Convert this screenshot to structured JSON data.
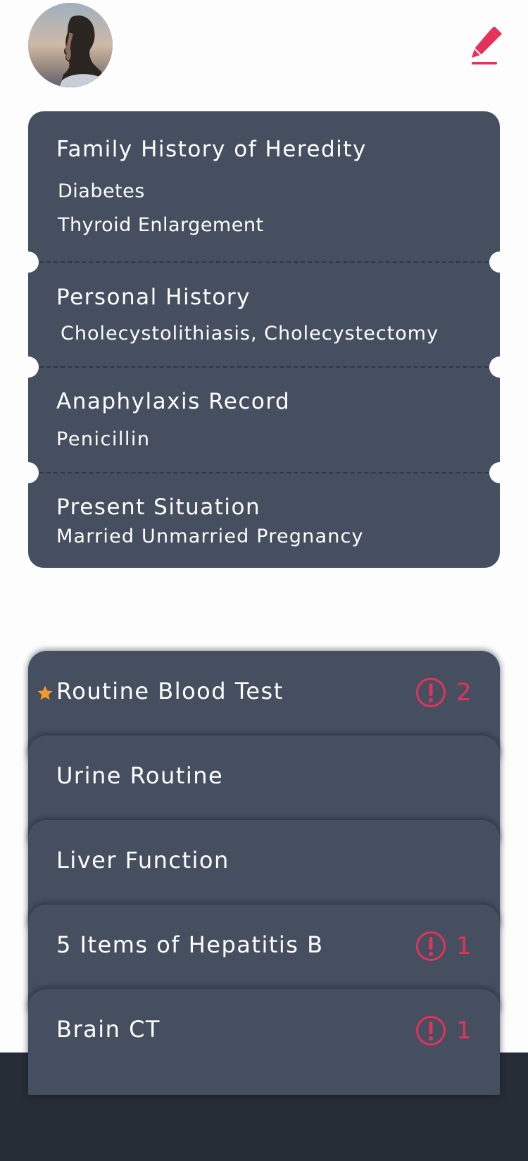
{
  "colors": {
    "card": "#454f60",
    "accent": "#e4325a",
    "star": "#f29a2e",
    "bottom_bar": "#272d37"
  },
  "header": {
    "avatar_icon": "user-avatar-photo",
    "edit_icon": "pencil-icon"
  },
  "health_card": {
    "family_history": {
      "title": "Family History of Heredity",
      "items": [
        "Diabetes",
        "Thyroid Enlargement"
      ]
    },
    "personal_history": {
      "title": "Personal History",
      "text": "Cholecystolithiasis, Cholecystectomy"
    },
    "anaphylaxis": {
      "title": "Anaphylaxis Record",
      "text": "Penicillin"
    },
    "present_situation": {
      "title": "Present Situation",
      "text": "Married Unmarried Pregnancy"
    }
  },
  "exams": [
    {
      "label": "Routine Blood Test",
      "starred": true,
      "warnings": "2"
    },
    {
      "label": "Urine Routine",
      "starred": false,
      "warnings": null
    },
    {
      "label": "Liver Function",
      "starred": false,
      "warnings": null
    },
    {
      "label": "5 Items of Hepatitis B",
      "starred": false,
      "warnings": "1"
    },
    {
      "label": "Brain CT",
      "starred": false,
      "warnings": "1"
    }
  ]
}
